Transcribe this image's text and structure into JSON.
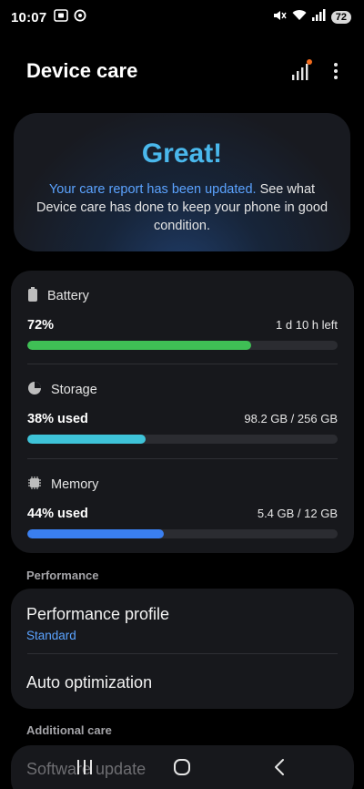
{
  "status_bar": {
    "time": "10:07",
    "left_icons": [
      "screen-recorder-icon",
      "vpn-icon"
    ],
    "right_icons": [
      "mute-icon",
      "wifi-icon",
      "cell-signal-icon"
    ],
    "battery": "72"
  },
  "header": {
    "title": "Device care",
    "actions": [
      "diagnostics-signal-icon",
      "more-options-icon"
    ]
  },
  "report": {
    "headline": "Great!",
    "link_text": "Your care report has been updated.",
    "body_text": " See what Device care has done to keep your phone in good condition."
  },
  "stats": {
    "battery": {
      "label": "Battery",
      "value": "72%",
      "detail": "1 d 10 h left",
      "level": 0.72,
      "color": "#3fbf55"
    },
    "storage": {
      "label": "Storage",
      "value": "38% used",
      "detail": "98.2 GB / 256 GB",
      "level": 0.38,
      "color": "#3ec3d8"
    },
    "memory": {
      "label": "Memory",
      "value": "44% used",
      "detail": "5.4 GB / 12 GB",
      "level": 0.44,
      "color": "#3a7ff0"
    }
  },
  "performance": {
    "section_label": "Performance",
    "profile_title": "Performance profile",
    "profile_value": "Standard",
    "auto_title": "Auto optimization"
  },
  "additional": {
    "section_label": "Additional care",
    "software_update": "Software update"
  },
  "nav": [
    "recents-icon",
    "home-icon",
    "back-icon"
  ]
}
